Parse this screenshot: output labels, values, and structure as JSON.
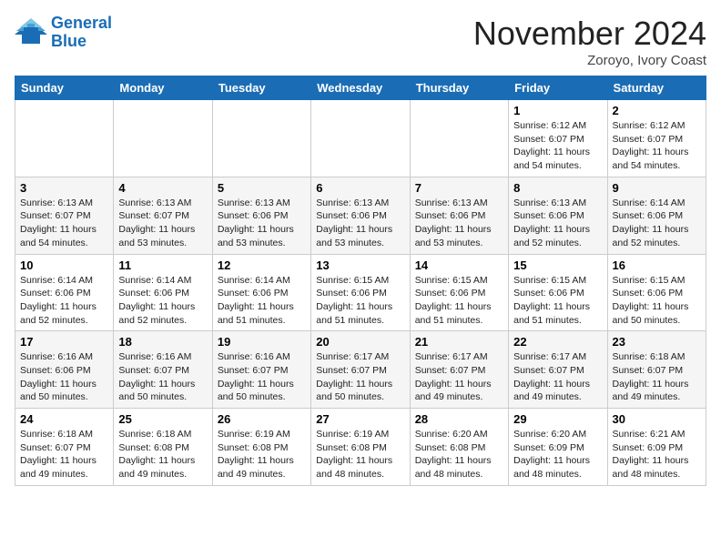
{
  "header": {
    "logo_line1": "General",
    "logo_line2": "Blue",
    "month": "November 2024",
    "location": "Zoroyo, Ivory Coast"
  },
  "weekdays": [
    "Sunday",
    "Monday",
    "Tuesday",
    "Wednesday",
    "Thursday",
    "Friday",
    "Saturday"
  ],
  "weeks": [
    [
      {
        "day": "",
        "info": ""
      },
      {
        "day": "",
        "info": ""
      },
      {
        "day": "",
        "info": ""
      },
      {
        "day": "",
        "info": ""
      },
      {
        "day": "",
        "info": ""
      },
      {
        "day": "1",
        "info": "Sunrise: 6:12 AM\nSunset: 6:07 PM\nDaylight: 11 hours\nand 54 minutes."
      },
      {
        "day": "2",
        "info": "Sunrise: 6:12 AM\nSunset: 6:07 PM\nDaylight: 11 hours\nand 54 minutes."
      }
    ],
    [
      {
        "day": "3",
        "info": "Sunrise: 6:13 AM\nSunset: 6:07 PM\nDaylight: 11 hours\nand 54 minutes."
      },
      {
        "day": "4",
        "info": "Sunrise: 6:13 AM\nSunset: 6:07 PM\nDaylight: 11 hours\nand 53 minutes."
      },
      {
        "day": "5",
        "info": "Sunrise: 6:13 AM\nSunset: 6:06 PM\nDaylight: 11 hours\nand 53 minutes."
      },
      {
        "day": "6",
        "info": "Sunrise: 6:13 AM\nSunset: 6:06 PM\nDaylight: 11 hours\nand 53 minutes."
      },
      {
        "day": "7",
        "info": "Sunrise: 6:13 AM\nSunset: 6:06 PM\nDaylight: 11 hours\nand 53 minutes."
      },
      {
        "day": "8",
        "info": "Sunrise: 6:13 AM\nSunset: 6:06 PM\nDaylight: 11 hours\nand 52 minutes."
      },
      {
        "day": "9",
        "info": "Sunrise: 6:14 AM\nSunset: 6:06 PM\nDaylight: 11 hours\nand 52 minutes."
      }
    ],
    [
      {
        "day": "10",
        "info": "Sunrise: 6:14 AM\nSunset: 6:06 PM\nDaylight: 11 hours\nand 52 minutes."
      },
      {
        "day": "11",
        "info": "Sunrise: 6:14 AM\nSunset: 6:06 PM\nDaylight: 11 hours\nand 52 minutes."
      },
      {
        "day": "12",
        "info": "Sunrise: 6:14 AM\nSunset: 6:06 PM\nDaylight: 11 hours\nand 51 minutes."
      },
      {
        "day": "13",
        "info": "Sunrise: 6:15 AM\nSunset: 6:06 PM\nDaylight: 11 hours\nand 51 minutes."
      },
      {
        "day": "14",
        "info": "Sunrise: 6:15 AM\nSunset: 6:06 PM\nDaylight: 11 hours\nand 51 minutes."
      },
      {
        "day": "15",
        "info": "Sunrise: 6:15 AM\nSunset: 6:06 PM\nDaylight: 11 hours\nand 51 minutes."
      },
      {
        "day": "16",
        "info": "Sunrise: 6:15 AM\nSunset: 6:06 PM\nDaylight: 11 hours\nand 50 minutes."
      }
    ],
    [
      {
        "day": "17",
        "info": "Sunrise: 6:16 AM\nSunset: 6:06 PM\nDaylight: 11 hours\nand 50 minutes."
      },
      {
        "day": "18",
        "info": "Sunrise: 6:16 AM\nSunset: 6:07 PM\nDaylight: 11 hours\nand 50 minutes."
      },
      {
        "day": "19",
        "info": "Sunrise: 6:16 AM\nSunset: 6:07 PM\nDaylight: 11 hours\nand 50 minutes."
      },
      {
        "day": "20",
        "info": "Sunrise: 6:17 AM\nSunset: 6:07 PM\nDaylight: 11 hours\nand 50 minutes."
      },
      {
        "day": "21",
        "info": "Sunrise: 6:17 AM\nSunset: 6:07 PM\nDaylight: 11 hours\nand 49 minutes."
      },
      {
        "day": "22",
        "info": "Sunrise: 6:17 AM\nSunset: 6:07 PM\nDaylight: 11 hours\nand 49 minutes."
      },
      {
        "day": "23",
        "info": "Sunrise: 6:18 AM\nSunset: 6:07 PM\nDaylight: 11 hours\nand 49 minutes."
      }
    ],
    [
      {
        "day": "24",
        "info": "Sunrise: 6:18 AM\nSunset: 6:07 PM\nDaylight: 11 hours\nand 49 minutes."
      },
      {
        "day": "25",
        "info": "Sunrise: 6:18 AM\nSunset: 6:08 PM\nDaylight: 11 hours\nand 49 minutes."
      },
      {
        "day": "26",
        "info": "Sunrise: 6:19 AM\nSunset: 6:08 PM\nDaylight: 11 hours\nand 49 minutes."
      },
      {
        "day": "27",
        "info": "Sunrise: 6:19 AM\nSunset: 6:08 PM\nDaylight: 11 hours\nand 48 minutes."
      },
      {
        "day": "28",
        "info": "Sunrise: 6:20 AM\nSunset: 6:08 PM\nDaylight: 11 hours\nand 48 minutes."
      },
      {
        "day": "29",
        "info": "Sunrise: 6:20 AM\nSunset: 6:09 PM\nDaylight: 11 hours\nand 48 minutes."
      },
      {
        "day": "30",
        "info": "Sunrise: 6:21 AM\nSunset: 6:09 PM\nDaylight: 11 hours\nand 48 minutes."
      }
    ]
  ]
}
